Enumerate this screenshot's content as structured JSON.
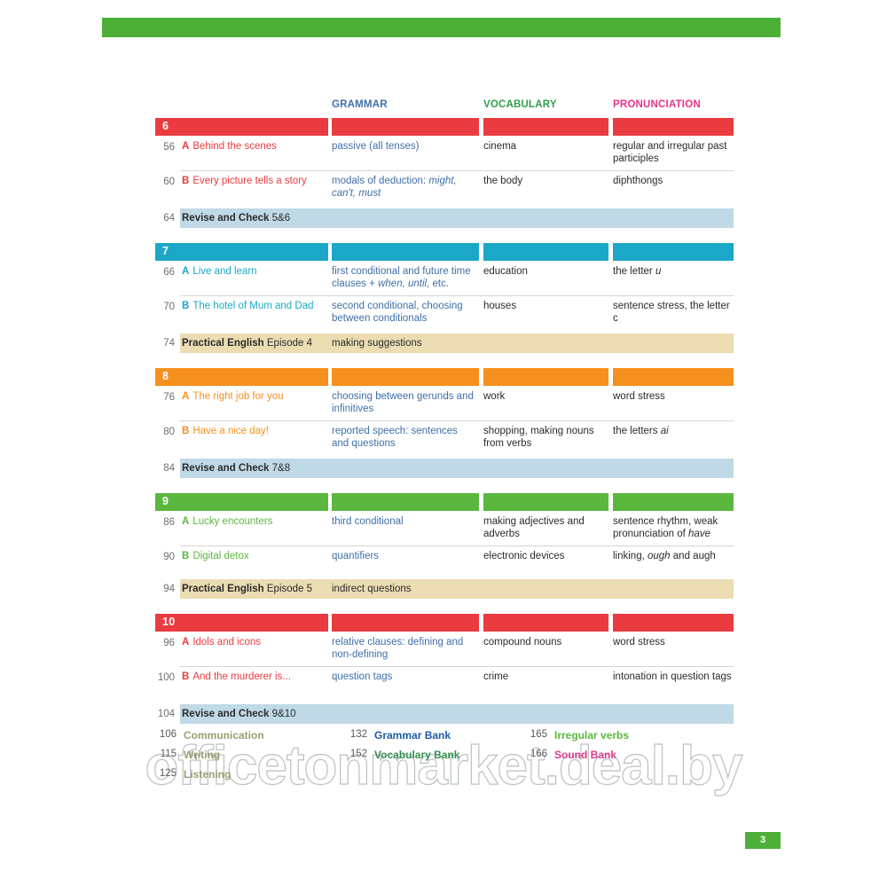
{
  "page": {
    "page_number": "3",
    "watermark": "officetonmarket.deal.by",
    "accent_green": "#4caf38"
  },
  "column_headers": {
    "grammar": "GRAMMAR",
    "vocabulary": "VOCABULARY",
    "pronunciation": "PRONUNCIATION"
  },
  "units": [
    {
      "number": "6",
      "color": "#ea3b40",
      "lessons": [
        {
          "page": "56",
          "letter": "A",
          "title": "Behind the scenes",
          "grammar": "passive (all tenses)",
          "vocabulary": "cinema",
          "pronunciation": "regular and irregular past participles"
        },
        {
          "page": "60",
          "letter": "B",
          "title": "Every picture tells a story",
          "grammar": "modals of deduction: might, can't, must",
          "grammar_italic_from": "might, can't, must",
          "vocabulary": "the body",
          "pronunciation": "diphthongs"
        }
      ],
      "special": {
        "page": "64",
        "kind": "revise",
        "bold_label": "Revise and Check",
        "label_rest": "5&6",
        "extra": ""
      }
    },
    {
      "number": "7",
      "color": "#1aa7c8",
      "lessons": [
        {
          "page": "66",
          "letter": "A",
          "title": "Live and learn",
          "grammar": "first conditional and future time clauses + when, until, etc.",
          "grammar_italic_from": "when, until,",
          "vocabulary": "education",
          "pronunciation": "the letter u",
          "pronunciation_italic_from": "u"
        },
        {
          "page": "70",
          "letter": "B",
          "title": "The hotel of Mum and Dad",
          "grammar": "second conditional, choosing between conditionals",
          "vocabulary": "houses",
          "pronunciation": "sentence stress, the letter c",
          "pronunciation_italic_from": "c"
        }
      ],
      "special": {
        "page": "74",
        "kind": "practical",
        "bold_label": "Practical English",
        "label_rest": "Episode 4",
        "extra": "making suggestions"
      }
    },
    {
      "number": "8",
      "color": "#f5901e",
      "lessons": [
        {
          "page": "76",
          "letter": "A",
          "title": "The right job for you",
          "grammar": "choosing between gerunds and infinitives",
          "vocabulary": "work",
          "pronunciation": "word stress"
        },
        {
          "page": "80",
          "letter": "B",
          "title": "Have a nice day!",
          "grammar": "reported speech: sentences and questions",
          "vocabulary": "shopping, making nouns from verbs",
          "pronunciation": "the letters ai",
          "pronunciation_italic_from": "ai"
        }
      ],
      "special": {
        "page": "84",
        "kind": "revise",
        "bold_label": "Revise and Check",
        "label_rest": "7&8",
        "extra": ""
      }
    },
    {
      "number": "9",
      "color": "#5cb73f",
      "lessons": [
        {
          "page": "86",
          "letter": "A",
          "title": "Lucky encounters",
          "grammar": "third conditional",
          "vocabulary": "making adjectives and adverbs",
          "pronunciation": "sentence rhythm, weak pronunciation of have",
          "pronunciation_italic_from": "have"
        },
        {
          "page": "90",
          "letter": "B",
          "title": "Digital detox",
          "grammar": "quantifiers",
          "vocabulary": "electronic devices",
          "pronunciation": "linking, ough and augh",
          "pronunciation_italic_from": "ough"
        }
      ],
      "special": {
        "page": "94",
        "kind": "practical",
        "bold_label": "Practical English",
        "label_rest": "Episode 5",
        "extra": "indirect questions"
      }
    },
    {
      "number": "10",
      "color": "#ea3b40",
      "lessons": [
        {
          "page": "96",
          "letter": "A",
          "title": "Idols and icons",
          "grammar": "relative clauses: defining and non-defining",
          "vocabulary": "compound nouns",
          "pronunciation": "word stress"
        },
        {
          "page": "100",
          "letter": "B",
          "title": "And the murderer is...",
          "grammar": "question tags",
          "vocabulary": "crime",
          "pronunciation": "intonation in question tags"
        }
      ],
      "special": {
        "page": "104",
        "kind": "revise",
        "bold_label": "Revise and Check",
        "label_rest": "9&10",
        "extra": ""
      }
    }
  ],
  "footer_index": [
    {
      "col1_num": "106",
      "col1_label": "Communication",
      "col1_color": "#9aa06e",
      "col2_num": "132",
      "col2_label": "Grammar Bank",
      "col2_color": "#1f5aa8",
      "col3_num": "165",
      "col3_label": "Irregular verbs",
      "col3_color": "#5cb73f"
    },
    {
      "col1_num": "115",
      "col1_label": "Writing",
      "col1_color": "#9aa06e",
      "col2_num": "152",
      "col2_label": "Vocabulary Bank",
      "col2_color": "#2f8f4b",
      "col3_num": "166",
      "col3_label": "Sound Bank",
      "col3_color": "#e8338c"
    },
    {
      "col1_num": "125",
      "col1_label": "Listening",
      "col1_color": "#9aa06e",
      "col2_num": "",
      "col2_label": "",
      "col2_color": "",
      "col3_num": "",
      "col3_label": "",
      "col3_color": ""
    }
  ]
}
